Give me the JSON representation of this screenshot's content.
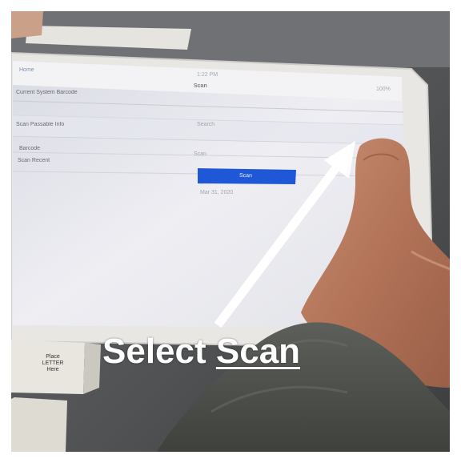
{
  "caption": {
    "lead": "Select",
    "emphasis": "Scan"
  },
  "screen": {
    "status_time": "1:22 PM",
    "status_battery": "100%",
    "back_label": "Home",
    "title": "Scan",
    "rows": [
      {
        "label": "Current System Barcode"
      },
      {
        "label": "Scan Passable Info",
        "value": "Search"
      },
      {
        "label": "Barcode",
        "value": "Scan"
      },
      {
        "label": "Scan Recent"
      }
    ],
    "scan_button_label": "Scan",
    "footnote": "Mar 31, 2020"
  },
  "colors": {
    "arrow": "#ffffff",
    "caption": "#ffffff",
    "scan_button": "#1f58d6"
  },
  "icons": [
    "arrow-annotation",
    "tablet-device",
    "hand"
  ]
}
